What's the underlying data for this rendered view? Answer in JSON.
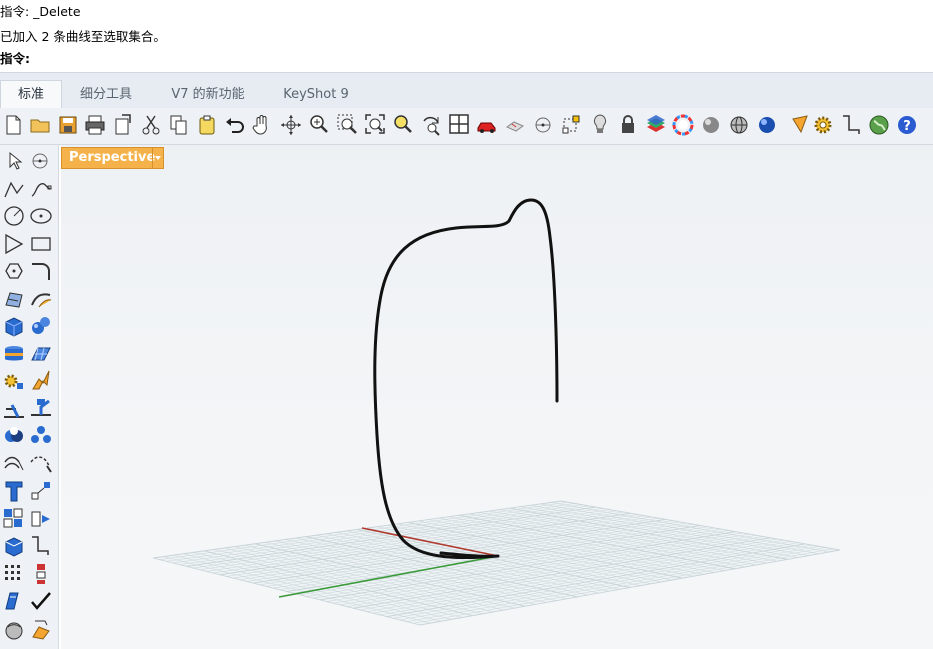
{
  "command_history": {
    "line1": "指令: _Delete",
    "line2": "已加入 2 条曲线至选取集合。",
    "prompt": "指令:"
  },
  "tabs": [
    {
      "label": "标准",
      "active": true
    },
    {
      "label": "细分工具",
      "active": false
    },
    {
      "label": "V7 的新功能",
      "active": false
    },
    {
      "label": "KeyShot 9",
      "active": false
    }
  ],
  "toolbar_icons": [
    "new-file-icon",
    "open-folder-icon",
    "save-icon",
    "print-icon",
    "import-icon",
    "cut-icon",
    "copy-icon",
    "paste-icon",
    "undo-icon",
    "pan-hand-icon",
    "rotate-view-icon",
    "zoom-icon",
    "zoom-window-icon",
    "zoom-extents-icon",
    "zoom-selected-icon",
    "rotate-camera-icon",
    "four-viewports-icon",
    "car-icon",
    "block-icon",
    "point-icon",
    "grid-snap-icon",
    "light-bulb-icon",
    "lock-icon",
    "layer-icon",
    "color-wheel-icon",
    "sphere-shaded-icon",
    "sphere-wire-icon",
    "render-sphere-icon",
    "render-cone-icon",
    "gear-icon",
    "dimension-icon",
    "globe-icon",
    "help-icon"
  ],
  "sidebar_icons": [
    "select-arrow-icon",
    "point-icon",
    "polyline-icon",
    "curve-icon",
    "circle-icon",
    "ellipse-icon",
    "polygon-icon",
    "rectangle-icon",
    "arc-icon",
    "fillet-curve-icon",
    "surface-corner-icon",
    "extrude-surface-icon",
    "box-solid-icon",
    "sphere-solid-icon",
    "cylinder-icon",
    "patch-icon",
    "explode-icon",
    "boolean-icon",
    "split-icon",
    "trim-icon",
    "boolean-union-icon",
    "boolean-diff-icon",
    "offset-curve-icon",
    "blend-icon",
    "text-object-icon",
    "transform-icon",
    "array-icon",
    "mirror-icon",
    "mesh-box-icon",
    "dimension-icon",
    "grid-array-icon",
    "align-icon",
    "analyze-icon",
    "check-icon",
    "shade-icon",
    "paint-icon"
  ],
  "viewport": {
    "label": "Perspective"
  },
  "colors": {
    "viewport_label_bg": "#f6b24a",
    "x_axis": "#b03a2e",
    "y_axis": "#3a9a3a",
    "curve": "#111111",
    "grid": "#c9d4d8"
  }
}
